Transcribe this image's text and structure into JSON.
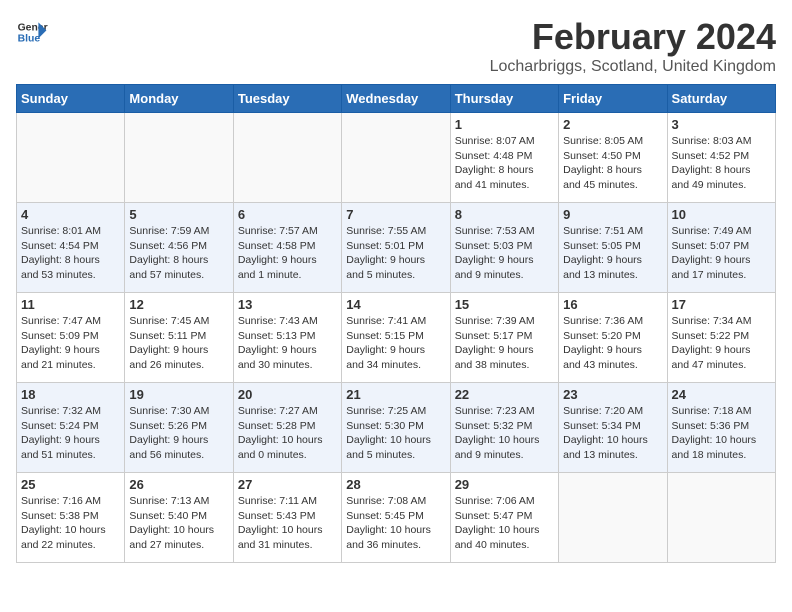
{
  "header": {
    "logo_general": "General",
    "logo_blue": "Blue",
    "month_title": "February 2024",
    "location": "Locharbriggs, Scotland, United Kingdom"
  },
  "weekdays": [
    "Sunday",
    "Monday",
    "Tuesday",
    "Wednesday",
    "Thursday",
    "Friday",
    "Saturday"
  ],
  "weeks": [
    [
      {
        "day": "",
        "info": ""
      },
      {
        "day": "",
        "info": ""
      },
      {
        "day": "",
        "info": ""
      },
      {
        "day": "",
        "info": ""
      },
      {
        "day": "1",
        "info": "Sunrise: 8:07 AM\nSunset: 4:48 PM\nDaylight: 8 hours\nand 41 minutes."
      },
      {
        "day": "2",
        "info": "Sunrise: 8:05 AM\nSunset: 4:50 PM\nDaylight: 8 hours\nand 45 minutes."
      },
      {
        "day": "3",
        "info": "Sunrise: 8:03 AM\nSunset: 4:52 PM\nDaylight: 8 hours\nand 49 minutes."
      }
    ],
    [
      {
        "day": "4",
        "info": "Sunrise: 8:01 AM\nSunset: 4:54 PM\nDaylight: 8 hours\nand 53 minutes."
      },
      {
        "day": "5",
        "info": "Sunrise: 7:59 AM\nSunset: 4:56 PM\nDaylight: 8 hours\nand 57 minutes."
      },
      {
        "day": "6",
        "info": "Sunrise: 7:57 AM\nSunset: 4:58 PM\nDaylight: 9 hours\nand 1 minute."
      },
      {
        "day": "7",
        "info": "Sunrise: 7:55 AM\nSunset: 5:01 PM\nDaylight: 9 hours\nand 5 minutes."
      },
      {
        "day": "8",
        "info": "Sunrise: 7:53 AM\nSunset: 5:03 PM\nDaylight: 9 hours\nand 9 minutes."
      },
      {
        "day": "9",
        "info": "Sunrise: 7:51 AM\nSunset: 5:05 PM\nDaylight: 9 hours\nand 13 minutes."
      },
      {
        "day": "10",
        "info": "Sunrise: 7:49 AM\nSunset: 5:07 PM\nDaylight: 9 hours\nand 17 minutes."
      }
    ],
    [
      {
        "day": "11",
        "info": "Sunrise: 7:47 AM\nSunset: 5:09 PM\nDaylight: 9 hours\nand 21 minutes."
      },
      {
        "day": "12",
        "info": "Sunrise: 7:45 AM\nSunset: 5:11 PM\nDaylight: 9 hours\nand 26 minutes."
      },
      {
        "day": "13",
        "info": "Sunrise: 7:43 AM\nSunset: 5:13 PM\nDaylight: 9 hours\nand 30 minutes."
      },
      {
        "day": "14",
        "info": "Sunrise: 7:41 AM\nSunset: 5:15 PM\nDaylight: 9 hours\nand 34 minutes."
      },
      {
        "day": "15",
        "info": "Sunrise: 7:39 AM\nSunset: 5:17 PM\nDaylight: 9 hours\nand 38 minutes."
      },
      {
        "day": "16",
        "info": "Sunrise: 7:36 AM\nSunset: 5:20 PM\nDaylight: 9 hours\nand 43 minutes."
      },
      {
        "day": "17",
        "info": "Sunrise: 7:34 AM\nSunset: 5:22 PM\nDaylight: 9 hours\nand 47 minutes."
      }
    ],
    [
      {
        "day": "18",
        "info": "Sunrise: 7:32 AM\nSunset: 5:24 PM\nDaylight: 9 hours\nand 51 minutes."
      },
      {
        "day": "19",
        "info": "Sunrise: 7:30 AM\nSunset: 5:26 PM\nDaylight: 9 hours\nand 56 minutes."
      },
      {
        "day": "20",
        "info": "Sunrise: 7:27 AM\nSunset: 5:28 PM\nDaylight: 10 hours\nand 0 minutes."
      },
      {
        "day": "21",
        "info": "Sunrise: 7:25 AM\nSunset: 5:30 PM\nDaylight: 10 hours\nand 5 minutes."
      },
      {
        "day": "22",
        "info": "Sunrise: 7:23 AM\nSunset: 5:32 PM\nDaylight: 10 hours\nand 9 minutes."
      },
      {
        "day": "23",
        "info": "Sunrise: 7:20 AM\nSunset: 5:34 PM\nDaylight: 10 hours\nand 13 minutes."
      },
      {
        "day": "24",
        "info": "Sunrise: 7:18 AM\nSunset: 5:36 PM\nDaylight: 10 hours\nand 18 minutes."
      }
    ],
    [
      {
        "day": "25",
        "info": "Sunrise: 7:16 AM\nSunset: 5:38 PM\nDaylight: 10 hours\nand 22 minutes."
      },
      {
        "day": "26",
        "info": "Sunrise: 7:13 AM\nSunset: 5:40 PM\nDaylight: 10 hours\nand 27 minutes."
      },
      {
        "day": "27",
        "info": "Sunrise: 7:11 AM\nSunset: 5:43 PM\nDaylight: 10 hours\nand 31 minutes."
      },
      {
        "day": "28",
        "info": "Sunrise: 7:08 AM\nSunset: 5:45 PM\nDaylight: 10 hours\nand 36 minutes."
      },
      {
        "day": "29",
        "info": "Sunrise: 7:06 AM\nSunset: 5:47 PM\nDaylight: 10 hours\nand 40 minutes."
      },
      {
        "day": "",
        "info": ""
      },
      {
        "day": "",
        "info": ""
      }
    ]
  ]
}
